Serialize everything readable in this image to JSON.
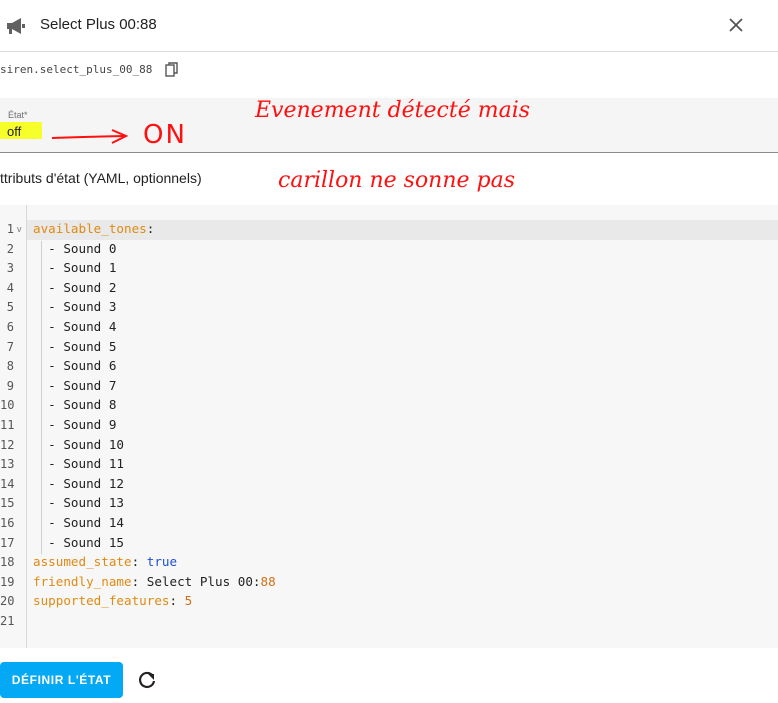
{
  "header": {
    "title": "Select Plus 00:88",
    "speaker_icon": "speaker-icon",
    "close_icon": "close-icon"
  },
  "entity": {
    "id": "siren.select_plus_00_88",
    "copy_icon": "copy-icon"
  },
  "state": {
    "label": "État*",
    "value": "off"
  },
  "attributes": {
    "label": "ttributs d'état (YAML, optionnels)"
  },
  "editor": {
    "line_numbers": [
      "1",
      "2",
      "3",
      "4",
      "5",
      "6",
      "7",
      "8",
      "9",
      "10",
      "11",
      "12",
      "13",
      "14",
      "15",
      "16",
      "17",
      "18",
      "19",
      "20",
      "21"
    ],
    "fold_marker": "v",
    "lines": [
      {
        "key": "available_tones",
        "sep": ":",
        "value": ""
      },
      {
        "indent": "  - ",
        "value": "Sound 0"
      },
      {
        "indent": "  - ",
        "value": "Sound 1"
      },
      {
        "indent": "  - ",
        "value": "Sound 2"
      },
      {
        "indent": "  - ",
        "value": "Sound 3"
      },
      {
        "indent": "  - ",
        "value": "Sound 4"
      },
      {
        "indent": "  - ",
        "value": "Sound 5"
      },
      {
        "indent": "  - ",
        "value": "Sound 6"
      },
      {
        "indent": "  - ",
        "value": "Sound 7"
      },
      {
        "indent": "  - ",
        "value": "Sound 8"
      },
      {
        "indent": "  - ",
        "value": "Sound 9"
      },
      {
        "indent": "  - ",
        "value": "Sound 10"
      },
      {
        "indent": "  - ",
        "value": "Sound 11"
      },
      {
        "indent": "  - ",
        "value": "Sound 12"
      },
      {
        "indent": "  - ",
        "value": "Sound 13"
      },
      {
        "indent": "  - ",
        "value": "Sound 14"
      },
      {
        "indent": "  - ",
        "value": "Sound 15"
      },
      {
        "key": "assumed_state",
        "sep": ": ",
        "value": "true"
      },
      {
        "key": "friendly_name",
        "sep": ": ",
        "value": "Select Plus 00",
        "value2_sep": ":",
        "value2": "88"
      },
      {
        "key": "supported_features",
        "sep": ": ",
        "value": "5"
      },
      {
        "value": ""
      }
    ]
  },
  "actions": {
    "set_state_label": "DÉFINIR L'ÉTAT",
    "refresh_icon": "refresh-icon"
  },
  "annotations": {
    "arrow_target": "ON",
    "line1": "Evenement détecté mais",
    "line2": "carillon ne sonne pas"
  },
  "colors": {
    "accent": "#03a9f4",
    "yaml_key": "#e08a12",
    "yaml_bool": "#1e4fd6",
    "yaml_number": "#d26e16",
    "highlight": "#f6ff2a",
    "annotation": "#ff1010"
  }
}
